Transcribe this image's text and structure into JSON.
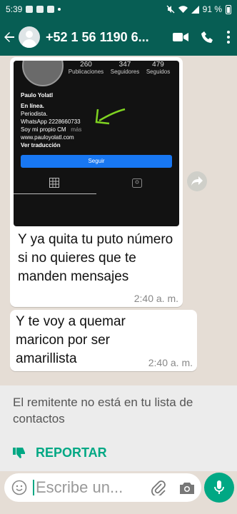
{
  "status_bar": {
    "time": "5:39",
    "battery": "91 %"
  },
  "app_bar": {
    "contact": "+52 1 56 1190 6..."
  },
  "messages": [
    {
      "type": "image",
      "instagram": {
        "stats": [
          {
            "value": "260",
            "label": "Publicaciones"
          },
          {
            "value": "347",
            "label": "Seguidores"
          },
          {
            "value": "479",
            "label": "Seguidos"
          }
        ],
        "name": "Paulo Yolatl",
        "lines": [
          "En línea.",
          "Periodista.",
          "WhatsApp 2228660733",
          "Soy mi propio CM",
          "www.pauloyolatl.com",
          "Ver traducción"
        ],
        "more": "más",
        "follow_button": "Seguir"
      },
      "caption": "Y ya quita tu puto número si no quieres que te manden mensajes",
      "time": "2:40 a. m."
    },
    {
      "type": "text",
      "text": "Y te voy a quemar maricon por ser amarillista",
      "time": "2:40 a. m."
    }
  ],
  "unknown_banner": {
    "text": "El remitente no está en tu lista de contactos",
    "report_label": "REPORTAR"
  },
  "composer": {
    "placeholder": "Escribe un..."
  },
  "colors": {
    "header": "#075e54",
    "accent": "#00a884",
    "chat_bg": "#e5ddd5"
  }
}
